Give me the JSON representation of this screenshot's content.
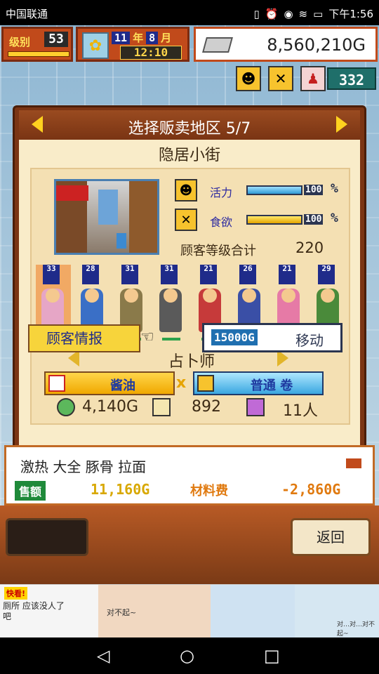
{
  "status_bar": {
    "carrier": "中国联通",
    "time": "下午1:56",
    "icons": [
      "cloud-icon",
      "vibrate-icon",
      "alarm-icon",
      "eye-icon",
      "wifi-icon",
      "signal-icon",
      "battery-icon"
    ]
  },
  "hud": {
    "level_label": "级别",
    "level_value": "53",
    "year": "11",
    "year_unit": "年",
    "month": "8",
    "month_unit": "月",
    "time": "12:10",
    "money": "8,560,210G",
    "visitors": "332"
  },
  "panel": {
    "title": "选择贩卖地区 5/7",
    "district": "隐居小街",
    "stats": [
      {
        "label": "活力",
        "value_label": "100",
        "percent_sign": "%",
        "fill": 1.0
      },
      {
        "label": "食欲",
        "value_label": "100",
        "percent_sign": "%",
        "fill": 1.0
      }
    ],
    "rank_label": "顾客等级合计",
    "rank_value": "220",
    "customers": [
      {
        "lv": "33",
        "color": "#e6a6c6",
        "selected": true
      },
      {
        "lv": "28",
        "color": "#3a6fc6",
        "selected": false
      },
      {
        "lv": "31",
        "color": "#8a7a4a",
        "selected": false
      },
      {
        "lv": "31",
        "color": "#5a5a5a",
        "selected": false
      },
      {
        "lv": "21",
        "color": "#c63a3a",
        "selected": false
      },
      {
        "lv": "26",
        "color": "#3a4fa6",
        "selected": false
      },
      {
        "lv": "21",
        "color": "#e67aa6",
        "selected": false
      },
      {
        "lv": "29",
        "color": "#4a8a3a",
        "selected": false
      }
    ],
    "customer_type": "占卜师",
    "product1": "酱油",
    "times_symbol": "x",
    "product2": "普通 卷",
    "money": "4,140G",
    "spoon_count": "892",
    "people": "11人",
    "info_button": "顾客情报",
    "move_price": "15000G",
    "move_label": "移动"
  },
  "sales": {
    "dish": "激热 大全 豚骨 拉面",
    "sales_label": "售额",
    "sales_value": "11,160G",
    "cost_label": "材料费",
    "cost_value": "-2,860G"
  },
  "buttons": {
    "back": "返回"
  },
  "ad": {
    "tag": "快看!",
    "text1": "厕所 应该没人了吧",
    "text2": "对不起~",
    "text3": "对…对…对不起~"
  },
  "colors": {
    "panel_frame": "#7b3514",
    "panel_body": "#f9ecc9",
    "accent_yellow": "#ffd21f",
    "hud_red": "#c14a1b"
  }
}
